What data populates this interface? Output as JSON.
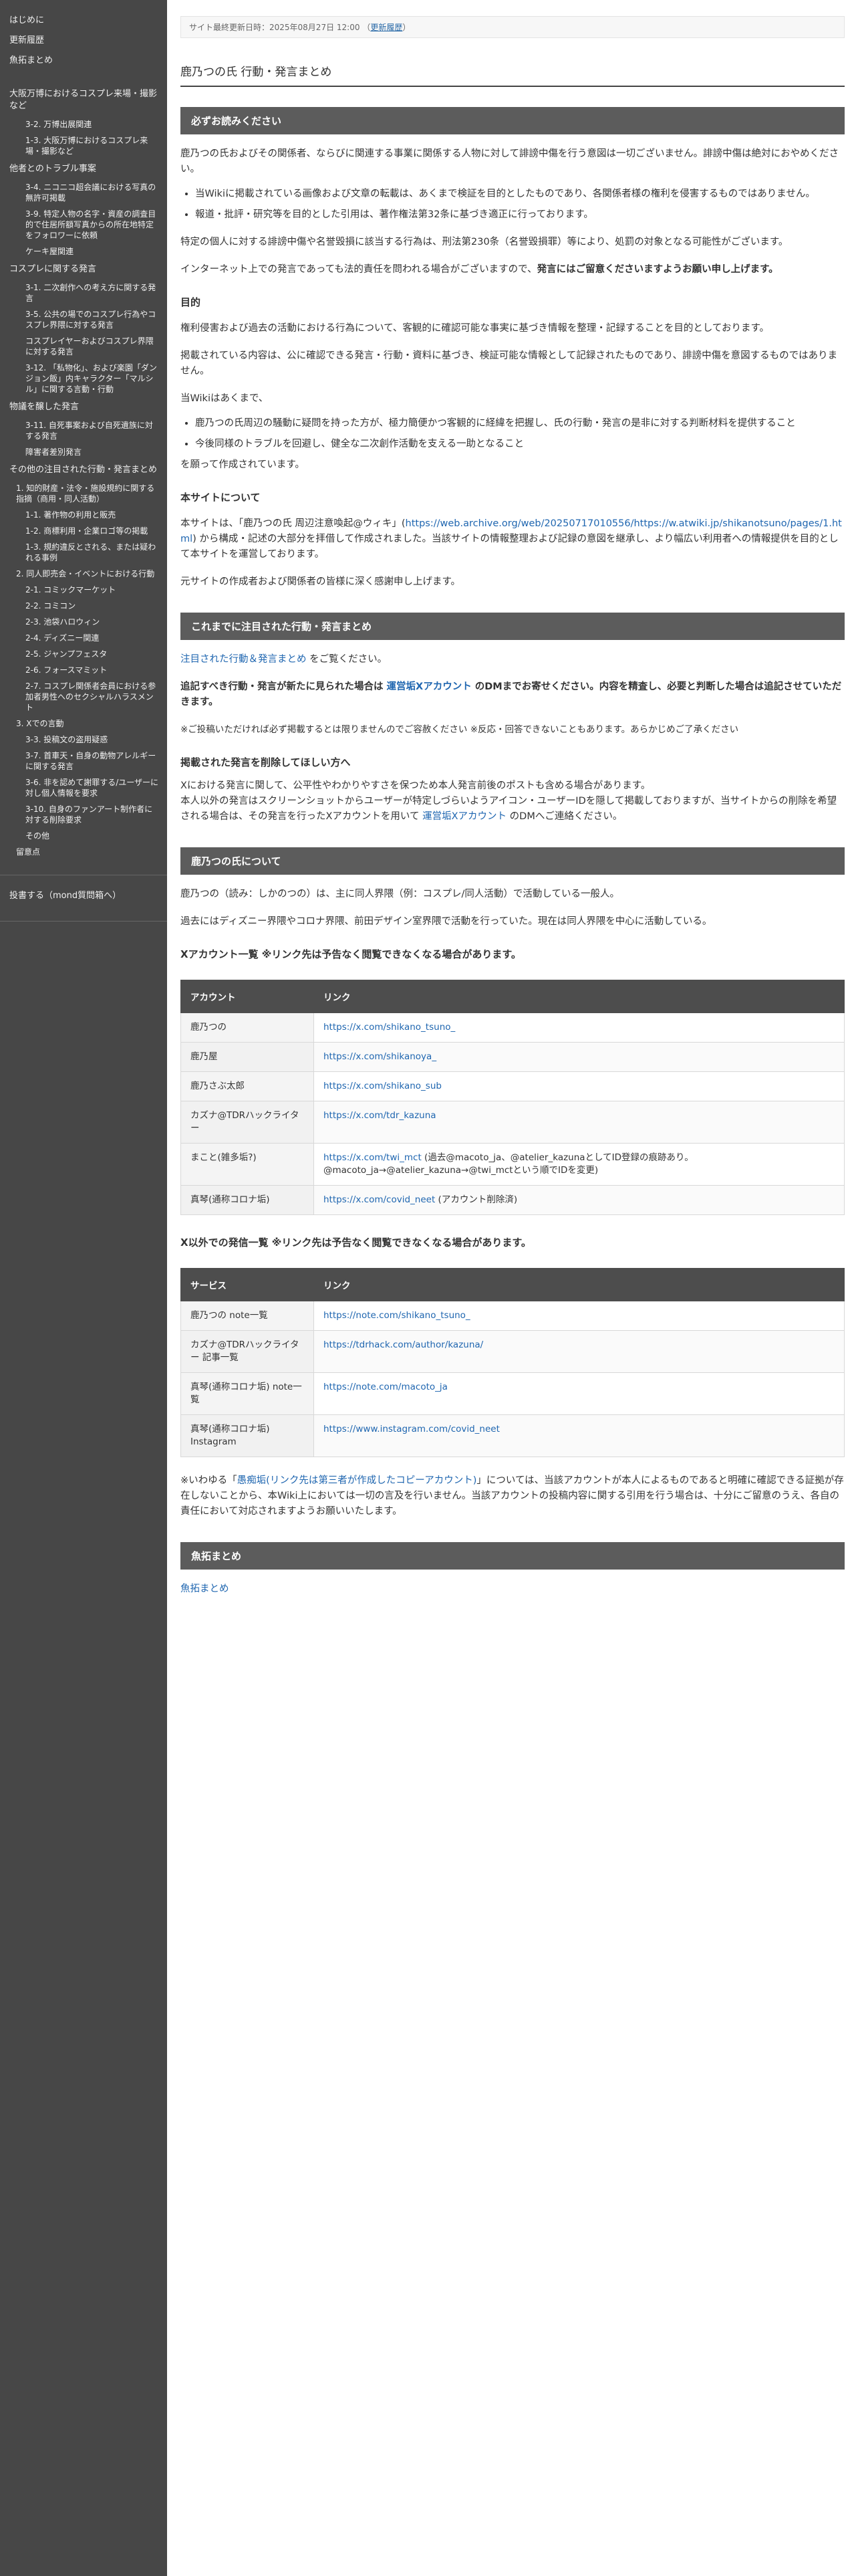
{
  "sidebar": {
    "group1": [
      "はじめに",
      "更新履歴",
      "魚拓まとめ"
    ],
    "expo": {
      "title": "大阪万博におけるコスプレ来場・撮影など",
      "items": [
        "3-2. 万博出展関連",
        "1-3. 大阪万博におけるコスプレ来場・撮影など"
      ]
    },
    "trouble": {
      "title": "他者とのトラブル事案",
      "items": [
        "3-4. ニコニコ超会議における写真の無許可掲載",
        "3-9. 特定人物の名字・資産の調査目的で住居所額写真からの所在地特定をフォロワーに依頼",
        "ケーキ屋関連"
      ]
    },
    "cosplay": {
      "title": "コスプレに関する発言",
      "items": [
        "3-1. 二次創作への考え方に関する発言",
        "3-5. 公共の場でのコスプレ行為やコスプレ界隈に対する発言",
        "コスプレイヤーおよびコスプレ界隈に対する発言",
        "3-12. 「私物化」、および楽園「ダンジョン飯」内キャラクター「マルシル」に関する言動・行動"
      ]
    },
    "crime": {
      "title": "物議を醸した発言",
      "items": [
        "3-11. 自死事案および自死遺族に対する発言",
        "障害者差別発言"
      ]
    },
    "others": {
      "title": "その他の注目された行動・発言まとめ",
      "items": [
        "1. 知的財産・法令・施設規約に関する指摘（商用・同人活動）",
        "1-1. 著作物の利用と販売",
        "1-2. 商標利用・企業ロゴ等の掲載",
        "1-3. 規約違反とされる、または疑われる事例",
        "2. 同人即売会・イベントにおける行動",
        "2-1. コミックマーケット",
        "2-2. コミコン",
        "2-3. 池袋ハロウィン",
        "2-4. ディズニー関連",
        "2-5. ジャンプフェスタ",
        "2-6. フォースマミット",
        "2-7. コスプレ関係者会員における参加者男性へのセクシャルハラスメント",
        "3. Xでの言動",
        "3-3. 投稿文の盗用疑惑",
        "3-7. 首車天・自身の動物アレルギーに関する発言",
        "3-6. 非を認めて謝罪する/ユーザーに対し個人情報を要求",
        "3-10. 自身のファンアート制作者に対する削除要求",
        "その他",
        "留意点"
      ]
    },
    "post": "投書する（mond質問箱へ）"
  },
  "meta": {
    "updated_label": "サイト最終更新日時：2025年08月27日 12:00",
    "history_link": "更新履歴"
  },
  "page_title": "鹿乃つの氏 行動・発言まとめ",
  "notice": {
    "head": "必ずお読みください",
    "p1": "鹿乃つの氏およびその関係者、ならびに関連する事業に関係する人物に対して誹謗中傷を行う意図は一切ございません。誹謗中傷は絶対におやめください。",
    "li1": "当Wikiに掲載されている画像および文章の転載は、あくまで検証を目的としたものであり、各関係者様の権利を侵害するものではありません。",
    "li2": "報道・批評・研究等を目的とした引用は、著作権法第32条に基づき適正に行っております。",
    "p2": "特定の個人に対する誹謗中傷や名誉毀損に該当する行為は、刑法第230条（名誉毀損罪）等により、処罰の対象となる可能性がございます。",
    "p3a": "インターネット上での発言であっても法的責任を問われる場合がございますので、",
    "p3b": "発言にはご留意くださいますようお願い申し上げます。",
    "purpose_h": "目的",
    "purpose_p1": "権利侵害および過去の活動における行為について、客観的に確認可能な事実に基づき情報を整理・記録することを目的としております。",
    "purpose_p2": "掲載されている内容は、公に確認できる発言・行動・資料に基づき、検証可能な情報として記録されたものであり、誹謗中傷を意図するものではありません。",
    "purpose_p3": "当Wikiはあくまで、",
    "purpose_li1": "鹿乃つの氏周辺の騒動に疑問を持った方が、極力簡便かつ客観的に経緯を把握し、氏の行動・発言の是非に対する判断材料を提供すること",
    "purpose_li2": "今後同様のトラブルを回避し、健全な二次創作活動を支える一助となること",
    "purpose_p4": "を願って作成されています。",
    "about_h": "本サイトについて",
    "about_p1a": "本サイトは、「鹿乃つの氏 周辺注意喚起@ウィキ」(",
    "about_link": "https://web.archive.org/web/20250717010556/https://w.atwiki.jp/shikanotsuno/pages/1.html",
    "about_p1b": ") から構成・記述の大部分を拝借して作成されました。当該サイトの情報整理および記録の意図を継承し、より幅広い利用者への情報提供を目的として本サイトを運営しております。",
    "about_p2": "元サイトの作成者および関係者の皆様に深く感謝申し上げます。"
  },
  "recent": {
    "head": "これまでに注目された行動・発言まとめ",
    "link": "注目された行動＆発言まとめ",
    "link_suffix": " をご覧ください。",
    "dm_a": "追記すべき行動・発言が新たに見られた場合は ",
    "dm_link": "運営垢Xアカウント",
    "dm_b": " のDMまでお寄せください。内容を精査し、必要と判断した場合は追記させていただきます。",
    "note": "※ご投稿いただければ必ず掲載するとは限りませんのでご容赦ください ※反応・回答できないこともあります。あらかじめご了承ください",
    "del_h": "掲載された発言を削除してほしい方へ",
    "del_p1": "Xにおける発言に関して、公平性やわかりやすさを保つため本人発言前後のポストも含める場合があります。",
    "del_p2a": "本人以外の発言はスクリーンショットからユーザーが特定しづらいようアイコン・ユーザーIDを隠して掲載しておりますが、当サイトからの削除を希望される場合は、その発言を行ったXアカウントを用いて ",
    "del_link": "運営垢Xアカウント",
    "del_p2b": " のDMへご連絡ください。"
  },
  "about_person": {
    "head": "鹿乃つの氏について",
    "p1": "鹿乃つの（読み：しかのつの）は、主に同人界隈（例：コスプレ/同人活動）で活動している一般人。",
    "p2": "過去にはディズニー界隈やコロナ界隈、前田デザイン室界隈で活動を行っていた。現在は同人界隈を中心に活動している。",
    "x_h": "Xアカウント一覧 ※リンク先は予告なく閲覧できなくなる場合があります。",
    "x_cols": [
      "アカウント",
      "リンク"
    ],
    "x_rows": [
      [
        "鹿乃つの",
        "https://x.com/shikano_tsuno_",
        ""
      ],
      [
        "鹿乃屋",
        "https://x.com/shikanoya_",
        ""
      ],
      [
        "鹿乃さぶ太郎",
        "https://x.com/shikano_sub",
        ""
      ],
      [
        "カズナ@TDRハックライター",
        "https://x.com/tdr_kazuna",
        ""
      ],
      [
        "まこと(雑多垢?)",
        "https://x.com/twi_mct",
        " (過去@macoto_ja、@atelier_kazunaとしてID登録の痕跡あり。@macoto_ja→@atelier_kazuna→@twi_mctという順でIDを変更)"
      ],
      [
        "真琴(通称コロナ垢)",
        "https://x.com/covid_neet",
        " (アカウント削除済)"
      ]
    ],
    "o_h": "X以外での発信一覧 ※リンク先は予告なく閲覧できなくなる場合があります。",
    "o_cols": [
      "サービス",
      "リンク"
    ],
    "o_rows": [
      [
        "鹿乃つの note一覧",
        "https://note.com/shikano_tsuno_"
      ],
      [
        "カズナ@TDRハックライター 記事一覧",
        "https://tdrhack.com/author/kazuna/"
      ],
      [
        "真琴(通称コロナ垢) note一覧",
        "https://note.com/macoto_ja"
      ],
      [
        "真琴(通称コロナ垢) Instagram",
        "https://www.instagram.com/covid_neet"
      ]
    ],
    "fake_a": "※いわゆる「",
    "fake_link": "愚痴垢(リンク先は第三者が作成したコピーアカウント)",
    "fake_b": "」については、当該アカウントが本人によるものであると明確に確認できる証拠が存在しないことから、本Wiki上においては一切の言及を行いません。当該アカウントの投稿内容に関する引用を行う場合は、十分にご留意のうえ、各自の責任において対応されますようお願いいたします。"
  },
  "gyotaku": {
    "head": "魚拓まとめ",
    "link": "魚拓まとめ"
  }
}
